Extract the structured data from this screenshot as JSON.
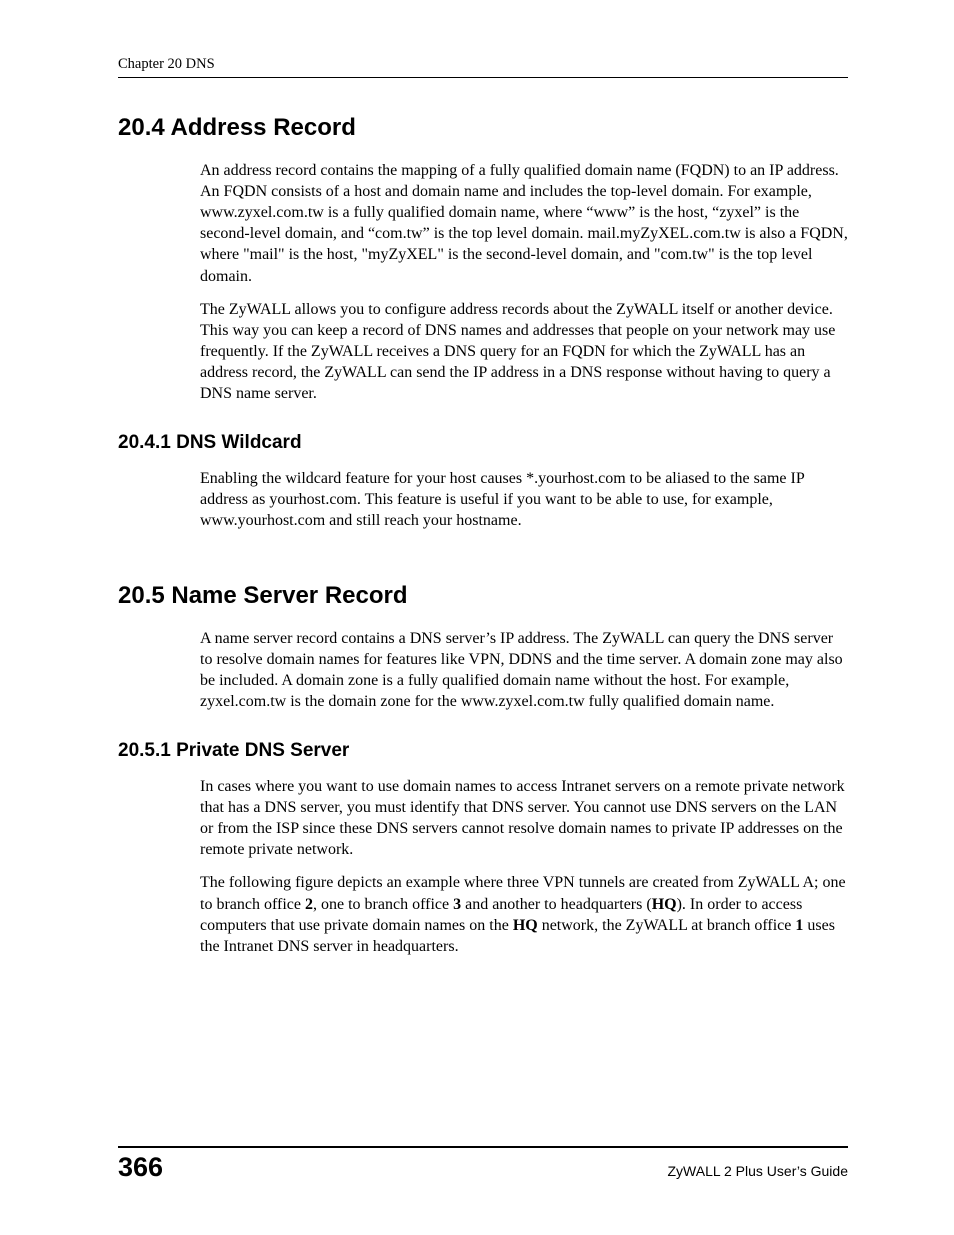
{
  "header": {
    "running": "Chapter 20 DNS"
  },
  "sections": {
    "s204": {
      "heading": "20.4  Address Record",
      "p1": "An address record contains the mapping of a fully qualified domain name (FQDN) to an IP address. An FQDN consists of a host and domain name and includes the top-level domain. For example, www.zyxel.com.tw is a fully qualified domain name, where “www” is the host, “zyxel” is the second-level domain, and “com.tw” is the top level domain. mail.myZyXEL.com.tw is also a FQDN, where \"mail\" is the host, \"myZyXEL\" is the second-level domain, and \"com.tw\" is the top level domain.",
      "p2": "The ZyWALL allows you to configure address records about the ZyWALL itself or another device. This way you can keep a record of DNS names and addresses that people on your network may use frequently. If the ZyWALL receives a DNS query for an FQDN for which the ZyWALL has an address record, the ZyWALL can send the IP address in a DNS response without having to query a DNS name server."
    },
    "s2041": {
      "heading": "20.4.1  DNS Wildcard",
      "p1": "Enabling the wildcard feature for your host causes *.yourhost.com to be aliased to the same IP address as yourhost.com. This feature is useful if you want to be able to use, for example, www.yourhost.com and still reach your hostname."
    },
    "s205": {
      "heading": "20.5  Name Server Record",
      "p1": "A name server record contains a DNS server’s IP address. The ZyWALL can query the DNS server to resolve domain names for features like VPN, DDNS and the time server. A domain zone may also be included. A domain zone is a fully qualified domain name without the host. For example, zyxel.com.tw is the domain zone for the www.zyxel.com.tw fully qualified domain name."
    },
    "s2051": {
      "heading": "20.5.1  Private DNS Server",
      "p1": "In cases where you want to use domain names to access Intranet servers on a remote private network that has a DNS server, you must identify that DNS server. You cannot use DNS servers on the LAN or from the ISP since these DNS servers cannot resolve domain names to private IP addresses on the remote private network.",
      "p2_parts": {
        "t1": "The following figure depicts an example where three VPN tunnels are created from ZyWALL A; one to branch office ",
        "b1": "2",
        "t2": ", one to branch office ",
        "b2": "3",
        "t3": " and another to headquarters (",
        "b3": "HQ",
        "t4": "). In order to access computers that use private domain names on the ",
        "b4": "HQ",
        "t5": " network, the ZyWALL at branch office ",
        "b5": "1",
        "t6": " uses the Intranet DNS server in headquarters."
      }
    }
  },
  "footer": {
    "page": "366",
    "guide": "ZyWALL 2 Plus User’s Guide"
  }
}
